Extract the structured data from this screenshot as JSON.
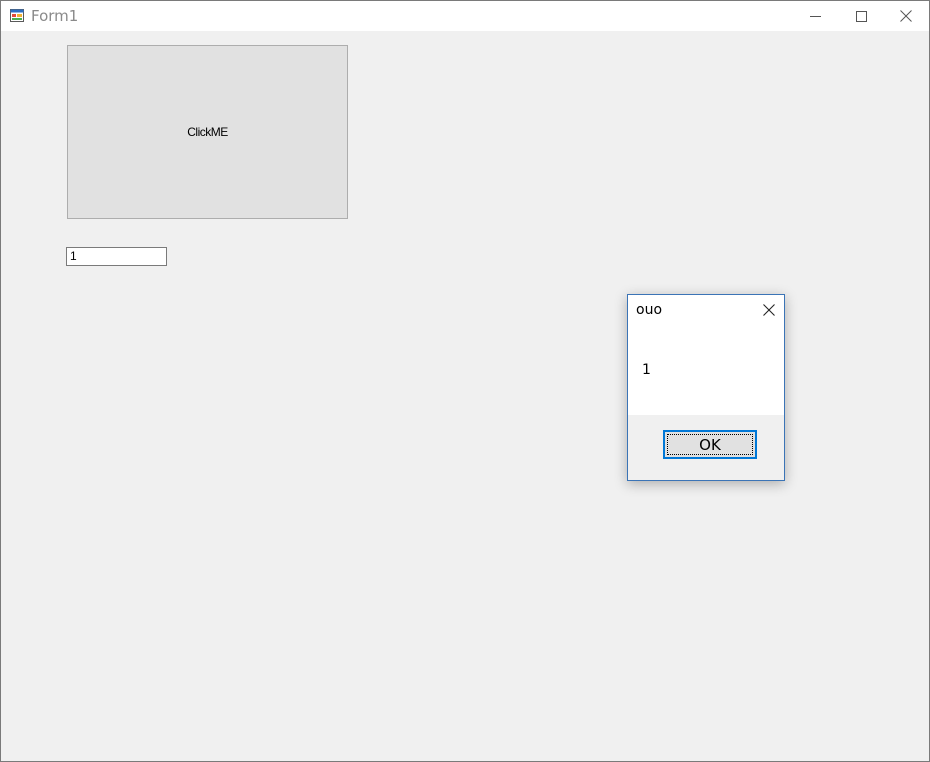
{
  "window": {
    "title": "Form1",
    "icon": "winforms-app-icon",
    "controls": [
      "minimize-icon",
      "maximize-icon",
      "close-icon"
    ]
  },
  "form": {
    "button_label": "ClickME",
    "textbox_value": "1"
  },
  "messagebox": {
    "title": "ouo",
    "message": "1",
    "ok_label": "OK",
    "close_icon": "close-icon"
  },
  "colors": {
    "background": "#f0f0f0",
    "button_face": "#e1e1e1",
    "focus_accent": "#0078d7",
    "dialog_border": "#3b74b6"
  }
}
